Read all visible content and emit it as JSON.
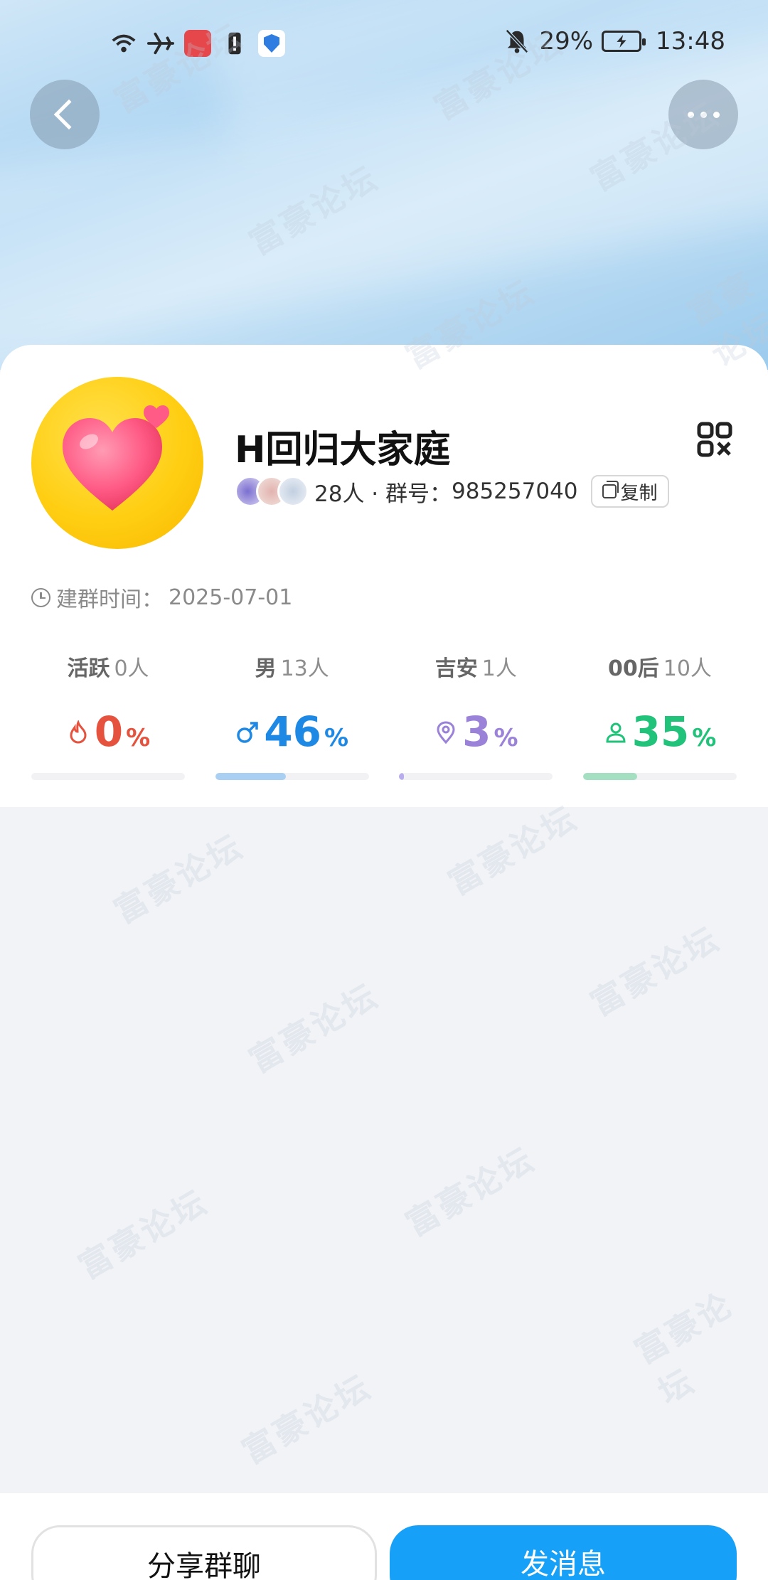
{
  "status_bar": {
    "battery_percent": "29%",
    "time": "13:48"
  },
  "group": {
    "name": "H回归大家庭",
    "members_text": "28人 · 群号：",
    "group_id": "985257040",
    "copy_label": "复制",
    "created_label": "建群时间：",
    "created_date": "2025-07-01"
  },
  "stats": [
    {
      "label": "活跃",
      "count": "0人",
      "value": "0",
      "unit": "%",
      "percent": 0,
      "color": "#e5533f",
      "icon": "flame-icon"
    },
    {
      "label": "男",
      "count": "13人",
      "value": "46",
      "unit": "%",
      "percent": 46,
      "color": "#1e88e5",
      "icon": "male-icon"
    },
    {
      "label": "吉安",
      "count": "1人",
      "value": "3",
      "unit": "%",
      "percent": 3,
      "color": "#9b82d9",
      "icon": "location-pin-icon"
    },
    {
      "label": "00后",
      "count": "10人",
      "value": "35",
      "unit": "%",
      "percent": 35,
      "color": "#21c27a",
      "icon": "person-icon"
    }
  ],
  "bar_colors": [
    "#e5533f",
    "#a9cff3",
    "#b9acee",
    "#a5dfc2"
  ],
  "actions": {
    "share_label": "分享群聊",
    "send_label": "发消息"
  },
  "watermark": "富豪论坛"
}
